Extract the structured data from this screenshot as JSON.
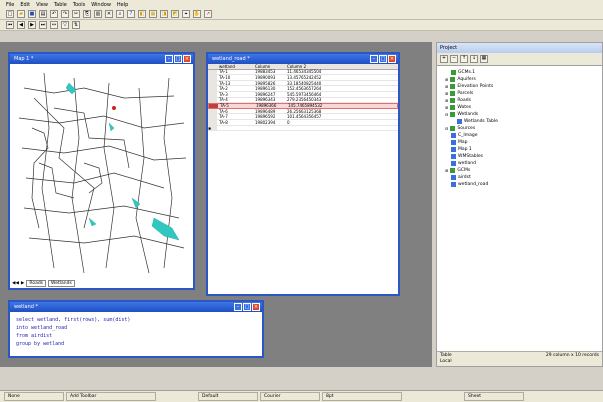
{
  "menu": [
    "File",
    "Edit",
    "View",
    "Table",
    "Tools",
    "Window",
    "Help"
  ],
  "toolbar_icons": [
    "new-icon",
    "open-icon",
    "save-icon",
    "print-icon",
    "undo-icon",
    "redo-icon",
    "cut-icon",
    "copy-icon",
    "paste-icon",
    "delete-icon",
    "find-icon",
    "print-preview-icon",
    "help-icon",
    "map-icon",
    "chart-icon",
    "layout-icon",
    "select-icon",
    "zoom-icon",
    "pan-icon",
    "info-icon",
    "ruler-icon",
    "pencil-icon"
  ],
  "map_window": {
    "title": "Map 1 *",
    "tabs": [
      "Roads",
      "Wetlands"
    ]
  },
  "table_window": {
    "title": "wetland_road *",
    "columns": [
      "wetland",
      "Column",
      "Column 2"
    ],
    "rows": [
      [
        "TA-1",
        "19883453",
        "11.46534345504"
      ],
      [
        "TA-10",
        "19890093",
        "13.45765242452"
      ],
      [
        "TA-13",
        "19895826",
        "33.18540825440"
      ],
      [
        "TA-2",
        "19896130",
        "152.4563657264"
      ],
      [
        "TA-3",
        "19896247",
        "545.5973456464"
      ],
      [
        "TA-4",
        "19896343",
        "279.2356450343"
      ],
      [
        "TA-5",
        "19896366",
        "145.7465894532"
      ],
      [
        "TA-6",
        "19896489",
        "26.25663125368"
      ],
      [
        "TA-7",
        "19896592",
        "101.4564356457"
      ],
      [
        "TA-8",
        "19802394",
        "0"
      ]
    ]
  },
  "sql_window": {
    "title": "wetland *",
    "lines": [
      "select wetland, first(rows), sum(dist)",
      "into wetland_road",
      "from airdist",
      "group by wetland"
    ]
  },
  "project_panel": {
    "title": "Project",
    "items": [
      "GCMs.1",
      "Aquifers",
      "Elevation Points",
      "Parcels",
      "Roads",
      "Wates",
      "Wetlands",
      "Wetlands Table",
      "Sources",
      "C_Image",
      "Map",
      "Map 1",
      "WMStables",
      "wetland",
      "GCMs",
      "airdst",
      "wetland_road"
    ],
    "status_left": "Table",
    "status_left2": "Local",
    "status_right": "29 column x 10 records"
  },
  "status": [
    "None",
    "Add Toolbar",
    "Default",
    "Courier",
    "8pt",
    "Sheet"
  ]
}
